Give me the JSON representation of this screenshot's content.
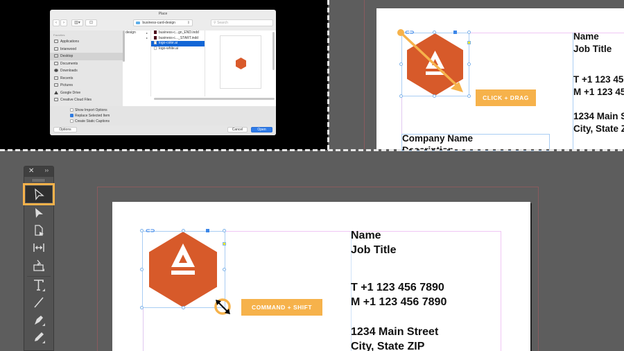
{
  "dialog": {
    "title": "Place",
    "toolbar": {
      "back_label": "‹",
      "forward_label": "›",
      "view_label": "▥▾",
      "newfolder_label": "⊡",
      "path_label": "business-card-design",
      "search_placeholder": "Search"
    },
    "sidebar": {
      "header": "Favorites",
      "items": [
        {
          "label": "Applications",
          "icon": "applications-icon",
          "selected": false
        },
        {
          "label": "brianwood",
          "icon": "home-icon",
          "selected": false
        },
        {
          "label": "Desktop",
          "icon": "desktop-icon",
          "selected": true
        },
        {
          "label": "Documents",
          "icon": "documents-icon",
          "selected": false
        },
        {
          "label": "Downloads",
          "icon": "downloads-icon",
          "selected": false
        },
        {
          "label": "Recents",
          "icon": "recents-icon",
          "selected": false
        },
        {
          "label": "Pictures",
          "icon": "pictures-icon",
          "selected": false
        },
        {
          "label": "Google Drive",
          "icon": "google-drive-icon",
          "selected": false
        },
        {
          "label": "Creative Cloud Files",
          "icon": "creative-cloud-icon",
          "selected": false
        }
      ]
    },
    "column1": [
      "design",
      ""
    ],
    "files": [
      {
        "name": "business-c...gn_END.indd",
        "type": "indd",
        "selected": false
      },
      {
        "name": "business-c..._START.indd",
        "type": "indd",
        "selected": false
      },
      {
        "name": "logo-color.ai",
        "type": "ai",
        "selected": true
      },
      {
        "name": "logo-white.ai",
        "type": "ai",
        "selected": false
      }
    ],
    "options": [
      {
        "label": "Show Import Options",
        "checked": false
      },
      {
        "label": "Replace Selected Item",
        "checked": true
      },
      {
        "label": "Create Static Captions",
        "checked": false
      }
    ],
    "footer": {
      "options_label": "Options",
      "cancel_label": "Cancel",
      "open_label": "Open"
    }
  },
  "business_card": {
    "name": "Name",
    "job_title": "Job Title",
    "phone_t": "T  +1 123 456 7890",
    "phone_m": "M +1 123 456 7890",
    "address_1": "1234 Main Street",
    "address_2": "City, State ZIP",
    "company": "Company Name",
    "description": "Description"
  },
  "callouts": {
    "click_drag": "CLICK + DRAG",
    "command_shift": "COMMAND + SHIFT"
  },
  "tools_panel": {
    "close_label": "✕",
    "collapse_label": "››",
    "tools": [
      {
        "name": "selection-tool",
        "active": true
      },
      {
        "name": "direct-selection-tool",
        "active": false
      },
      {
        "name": "page-tool",
        "active": false
      },
      {
        "name": "gap-tool",
        "active": false
      },
      {
        "name": "content-collector-tool",
        "active": false
      },
      {
        "name": "type-tool",
        "active": false
      },
      {
        "name": "line-tool",
        "active": false
      },
      {
        "name": "pen-tool",
        "active": false
      },
      {
        "name": "pencil-tool",
        "active": false
      }
    ]
  },
  "colors": {
    "accent_orange": "#f6b24b",
    "logo_orange": "#d75a2a",
    "selection_blue": "#1266d6",
    "frame_blue": "#a9cdf3",
    "pasteboard": "#5d5d5d"
  }
}
